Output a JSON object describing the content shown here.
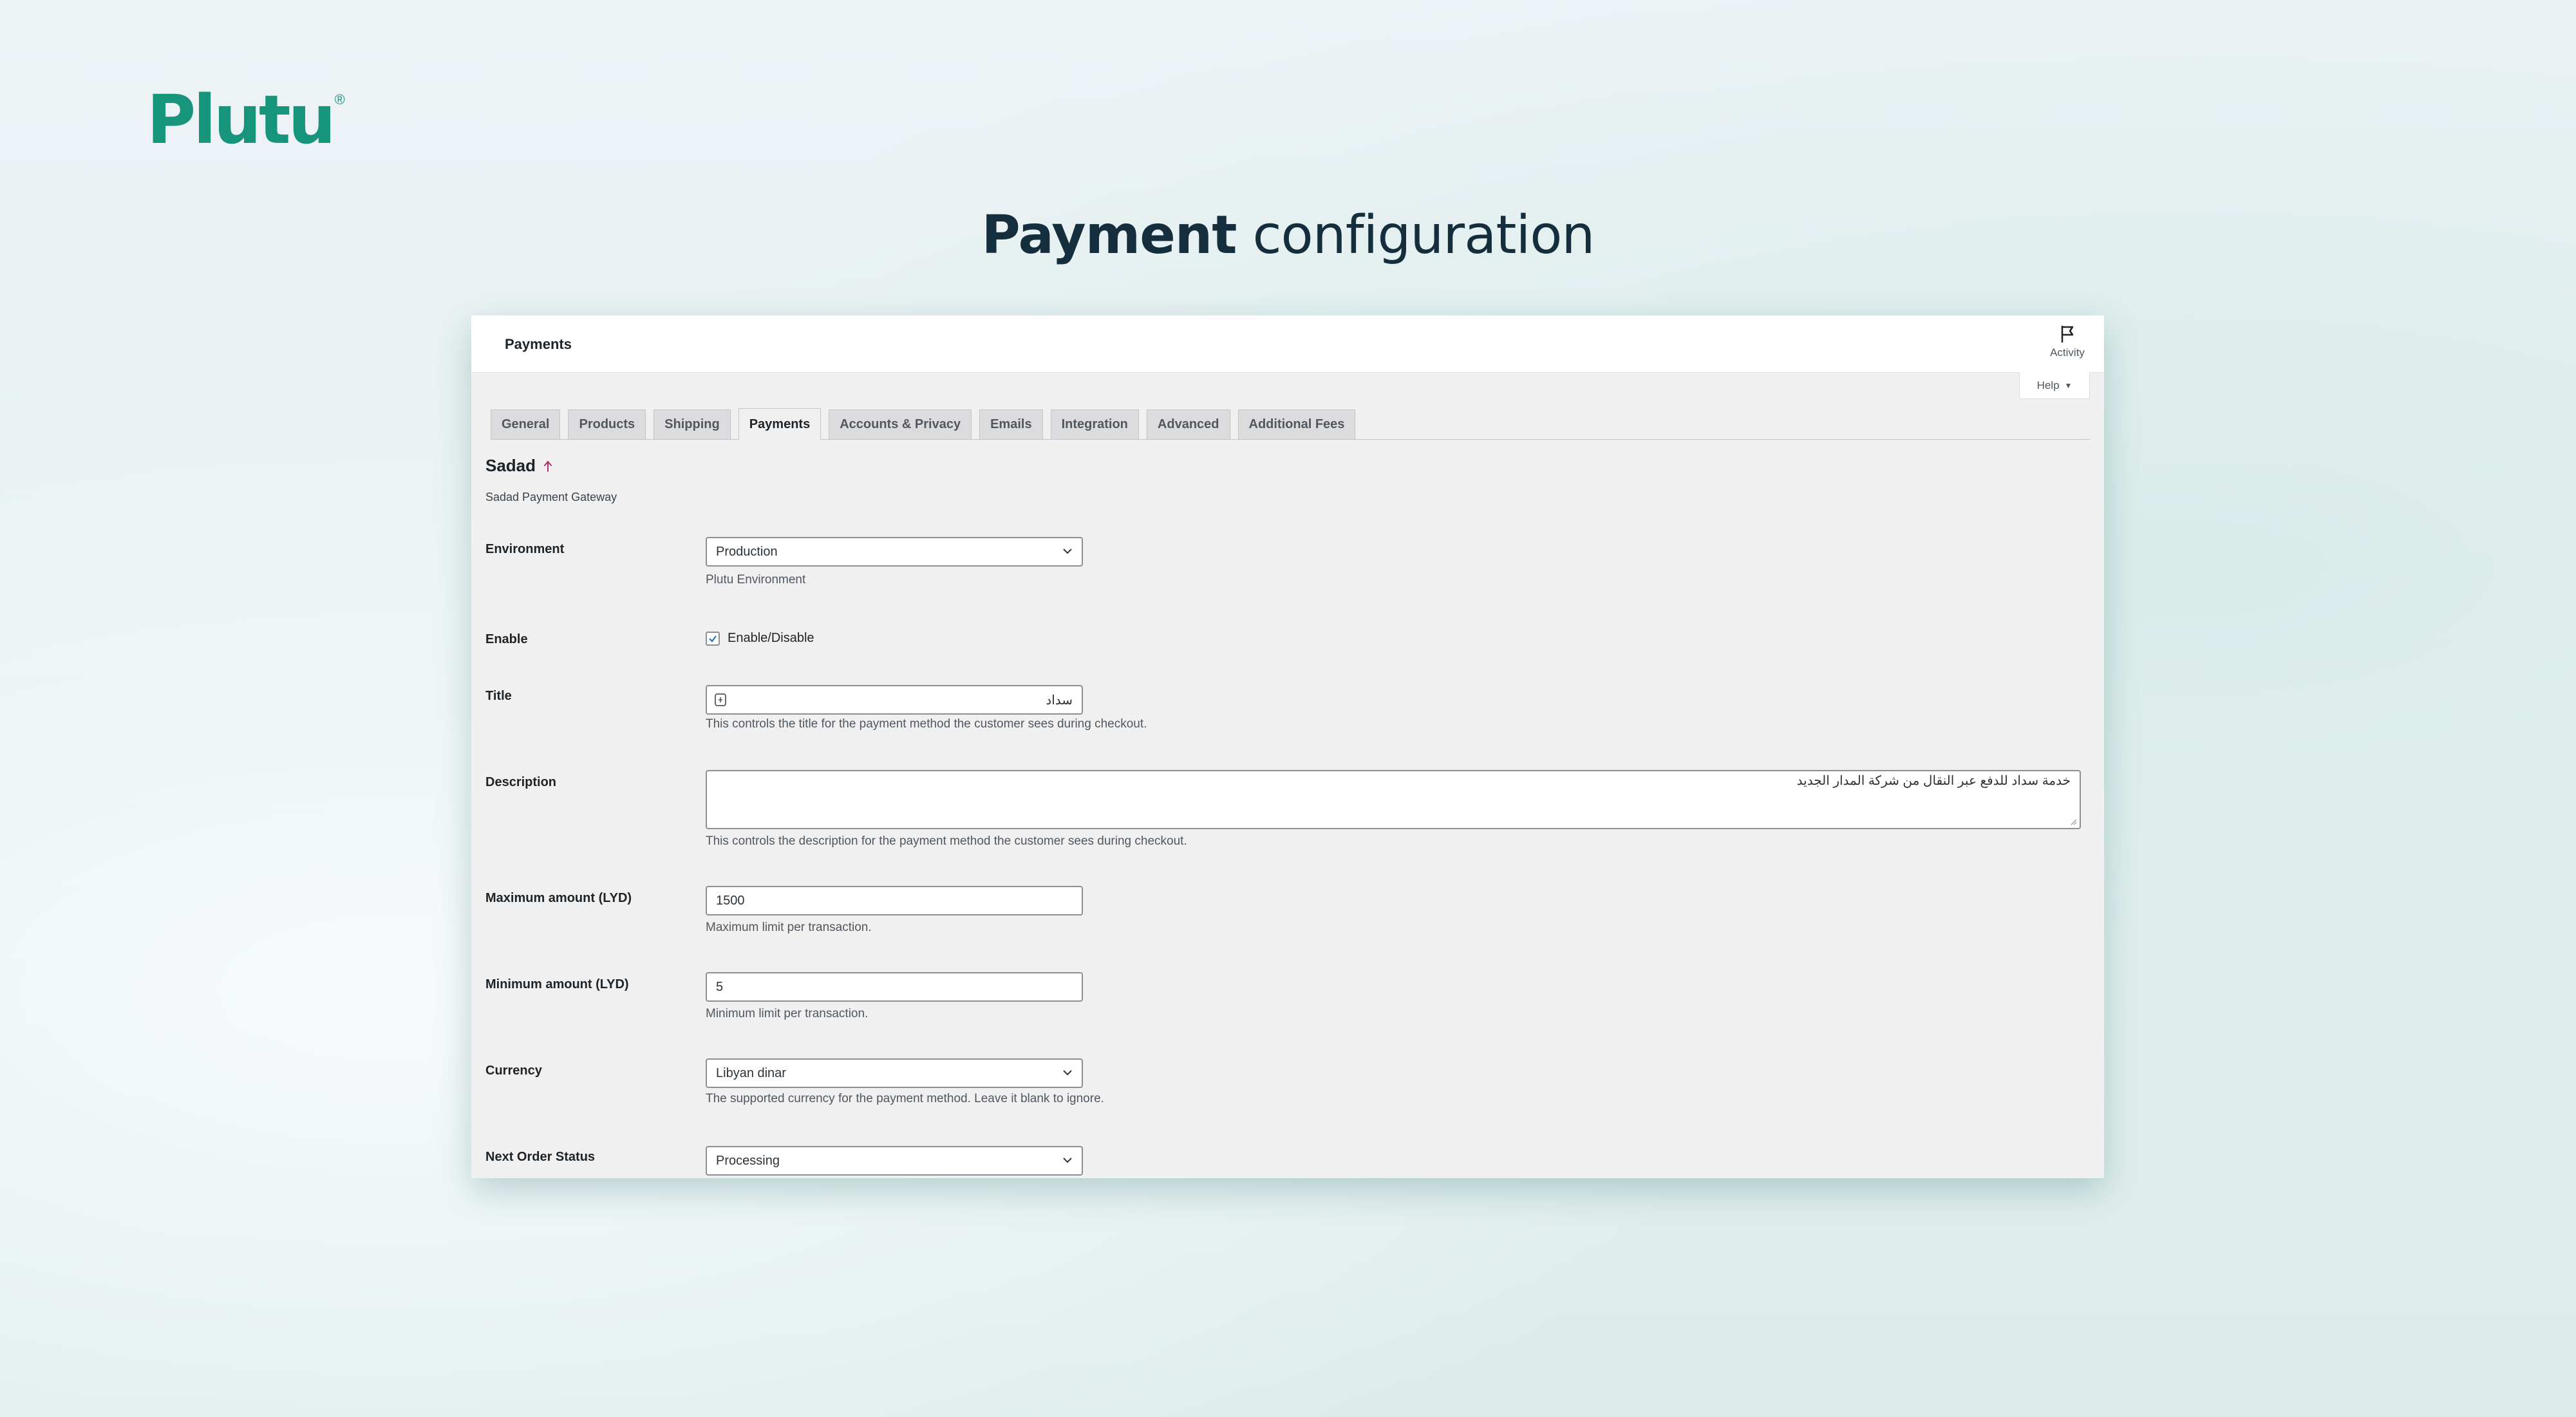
{
  "brand": {
    "logo_text": "Plutu",
    "logo_mark": "®",
    "accent_color": "#17957c"
  },
  "heading": {
    "strong": "Payment",
    "light": "configuration"
  },
  "topbar": {
    "title": "Payments",
    "activity_label": "Activity",
    "activity_icon": "flag-icon",
    "help_label": "Help"
  },
  "tabs": [
    {
      "label": "General",
      "active": false
    },
    {
      "label": "Products",
      "active": false
    },
    {
      "label": "Shipping",
      "active": false
    },
    {
      "label": "Payments",
      "active": true
    },
    {
      "label": "Accounts & Privacy",
      "active": false
    },
    {
      "label": "Emails",
      "active": false
    },
    {
      "label": "Integration",
      "active": false
    },
    {
      "label": "Advanced",
      "active": false
    },
    {
      "label": "Additional Fees",
      "active": false
    }
  ],
  "section": {
    "title": "Sadad",
    "description": "Sadad Payment Gateway",
    "title_icon": "up-arrow-icon"
  },
  "form": {
    "environment": {
      "label": "Environment",
      "value": "Production",
      "help": "Plutu Environment"
    },
    "enable": {
      "label": "Enable",
      "checkbox_label": "Enable/Disable",
      "checked": true
    },
    "title": {
      "label": "Title",
      "value": "سداد",
      "help": "This controls the title for the payment method the customer sees during checkout."
    },
    "description": {
      "label": "Description",
      "value": "خدمة سداد للدفع عبر النقال من شركة المدار الجديد",
      "help": "This controls the description for the payment method the customer sees during checkout."
    },
    "max_amount": {
      "label": "Maximum amount (LYD)",
      "value": "1500",
      "help": "Maximum limit per transaction."
    },
    "min_amount": {
      "label": "Minimum amount (LYD)",
      "value": "5",
      "help": "Minimum limit per transaction."
    },
    "currency": {
      "label": "Currency",
      "value": "Libyan dinar",
      "help": "The supported currency for the payment method. Leave it blank to ignore."
    },
    "next_order_status": {
      "label": "Next Order Status",
      "value": "Processing"
    }
  }
}
